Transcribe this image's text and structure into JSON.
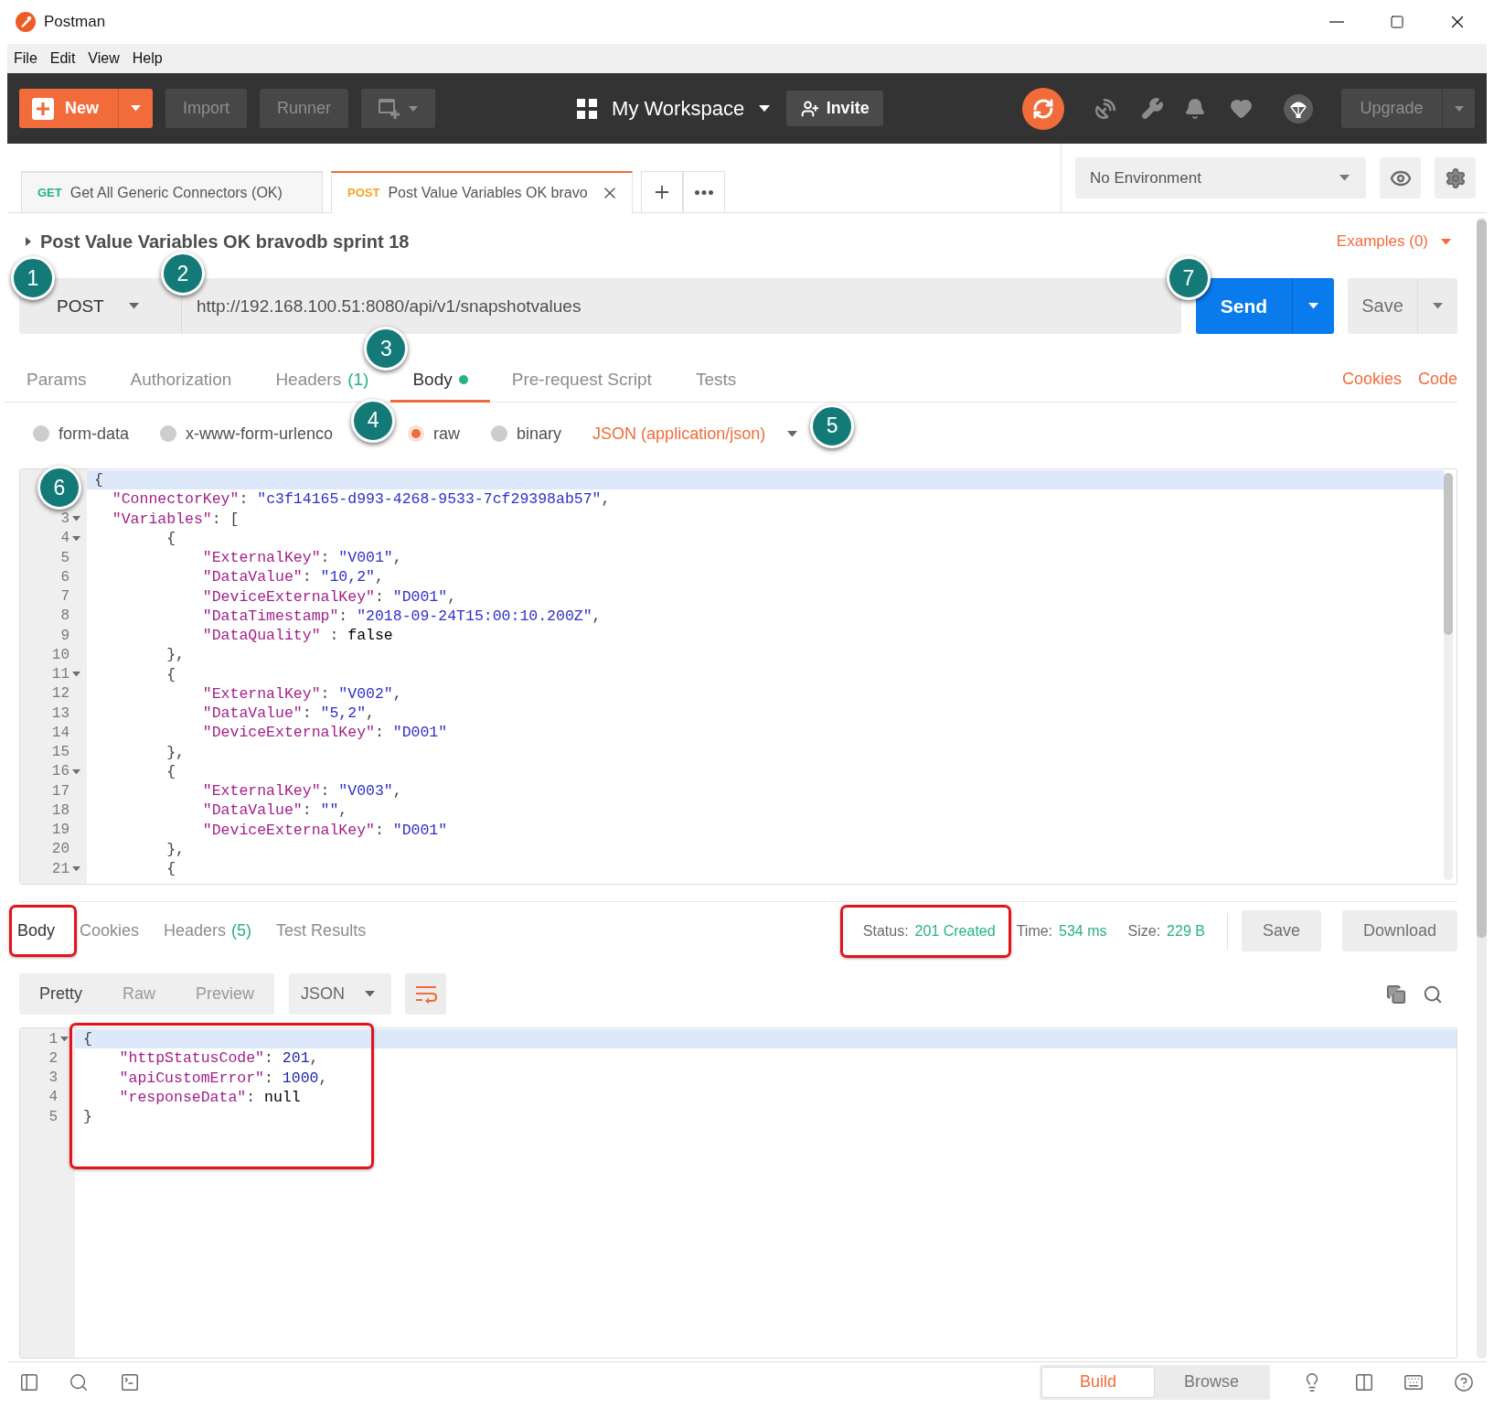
{
  "window": {
    "title": "Postman"
  },
  "menu": [
    "File",
    "Edit",
    "View",
    "Help"
  ],
  "toolbar": {
    "new": "New",
    "import": "Import",
    "runner": "Runner",
    "workspace": "My Workspace",
    "invite": "Invite",
    "upgrade": "Upgrade"
  },
  "tabs": [
    {
      "method": "GET",
      "color": "#26b47f",
      "label": "Get All Generic Connectors (OK)",
      "selected": false,
      "closable": false
    },
    {
      "method": "POST",
      "color": "#f5a623",
      "label": "Post Value Variables OK bravo",
      "selected": true,
      "closable": true
    }
  ],
  "environment": "No Environment",
  "request": {
    "title": "Post Value Variables OK bravodb sprint 18",
    "examples": "Examples (0)",
    "method": {
      "value": "POST",
      "callout": "1"
    },
    "url": {
      "value": "http://192.168.100.51:8080/api/v1/snapshotvalues",
      "callout": "2"
    },
    "send": {
      "label": "Send",
      "callout": "7"
    },
    "save": "Save"
  },
  "request_tabs": [
    {
      "label": "Params",
      "selected": false,
      "indicator": false
    },
    {
      "label": "Authorization",
      "selected": false,
      "indicator": false
    },
    {
      "label": "Headers",
      "count": "(1)",
      "selected": false,
      "indicator": false
    },
    {
      "label": "Body",
      "selected": true,
      "indicator": true,
      "callout": "3"
    },
    {
      "label": "Pre-request Script",
      "selected": false,
      "indicator": false
    },
    {
      "label": "Tests",
      "selected": false,
      "indicator": false
    }
  ],
  "request_links": [
    "Cookies",
    "Code"
  ],
  "body_types": [
    {
      "label": "form-data",
      "selected": false
    },
    {
      "label": "x-www-form-urlenco",
      "selected": false
    },
    {
      "label": "raw",
      "selected": true,
      "callout": "4"
    },
    {
      "label": "binary",
      "selected": false
    }
  ],
  "body_format": {
    "value": "JSON (application/json)",
    "callout": "5"
  },
  "editor": {
    "callout": "6",
    "lines": [
      {
        "active": true,
        "foldable": false,
        "tokens": [
          {
            "kind": "punct",
            "text": "{"
          }
        ],
        "children": [
          {
            "active": false,
            "foldable": false,
            "tokens": [
              {
                "kind": "key",
                "text": "\"ConnectorKey\""
              },
              {
                "kind": "punct",
                "text": ": "
              },
              {
                "kind": "str",
                "text": "\"c3f14165-d993-4268-9533-7cf29398ab57\""
              },
              {
                "kind": "punct",
                "text": ","
              }
            ]
          },
          {
            "number": "3",
            "active": false,
            "foldable": true,
            "tokens": [
              {
                "kind": "key",
                "text": "\"Variables\""
              },
              {
                "kind": "punct",
                "text": ": ["
              }
            ],
            "children": [
              {
                "number": "4",
                "active": false,
                "foldable": true,
                "tokens": [
                  {
                    "kind": "punct",
                    "text": "{"
                  }
                ],
                "children": [
                  {
                    "number": "5",
                    "active": false,
                    "foldable": false,
                    "tokens": [
                      {
                        "kind": "key",
                        "text": "\"ExternalKey\""
                      },
                      {
                        "kind": "punct",
                        "text": ": "
                      },
                      {
                        "kind": "str",
                        "text": "\"V001\""
                      },
                      {
                        "kind": "punct",
                        "text": ","
                      }
                    ]
                  },
                  {
                    "number": "6",
                    "active": false,
                    "foldable": false,
                    "tokens": [
                      {
                        "kind": "key",
                        "text": "\"DataValue\""
                      },
                      {
                        "kind": "punct",
                        "text": ": "
                      },
                      {
                        "kind": "str",
                        "text": "\"10,2\""
                      },
                      {
                        "kind": "punct",
                        "text": ","
                      }
                    ]
                  },
                  {
                    "number": "7",
                    "active": false,
                    "foldable": false,
                    "tokens": [
                      {
                        "kind": "key",
                        "text": "\"DeviceExternalKey\""
                      },
                      {
                        "kind": "punct",
                        "text": ": "
                      },
                      {
                        "kind": "str",
                        "text": "\"D001\""
                      },
                      {
                        "kind": "punct",
                        "text": ","
                      }
                    ]
                  },
                  {
                    "number": "8",
                    "active": false,
                    "foldable": false,
                    "tokens": [
                      {
                        "kind": "key",
                        "text": "\"DataTimestamp\""
                      },
                      {
                        "kind": "punct",
                        "text": ": "
                      },
                      {
                        "kind": "str",
                        "text": "\"2018-09-24T15:00:10.200Z\""
                      },
                      {
                        "kind": "punct",
                        "text": ","
                      }
                    ]
                  },
                  {
                    "number": "9",
                    "active": false,
                    "foldable": false,
                    "tokens": [
                      {
                        "kind": "key",
                        "text": "\"DataQuality\""
                      },
                      {
                        "kind": "punct",
                        "text": " : "
                      },
                      {
                        "kind": "kw",
                        "text": "false"
                      }
                    ]
                  }
                ]
              },
              {
                "number": "10",
                "active": false,
                "foldable": false,
                "tokens": [
                  {
                    "kind": "punct",
                    "text": "},"
                  }
                ]
              },
              {
                "number": "11",
                "active": false,
                "foldable": true,
                "tokens": [
                  {
                    "kind": "punct",
                    "text": "{"
                  }
                ],
                "children": [
                  {
                    "number": "12",
                    "active": false,
                    "foldable": false,
                    "tokens": [
                      {
                        "kind": "key",
                        "text": "\"ExternalKey\""
                      },
                      {
                        "kind": "punct",
                        "text": ": "
                      },
                      {
                        "kind": "str",
                        "text": "\"V002\""
                      },
                      {
                        "kind": "punct",
                        "text": ","
                      }
                    ]
                  },
                  {
                    "number": "13",
                    "active": false,
                    "foldable": false,
                    "tokens": [
                      {
                        "kind": "key",
                        "text": "\"DataValue\""
                      },
                      {
                        "kind": "punct",
                        "text": ": "
                      },
                      {
                        "kind": "str",
                        "text": "\"5,2\""
                      },
                      {
                        "kind": "punct",
                        "text": ","
                      }
                    ]
                  },
                  {
                    "number": "14",
                    "active": false,
                    "foldable": false,
                    "tokens": [
                      {
                        "kind": "key",
                        "text": "\"DeviceExternalKey\""
                      },
                      {
                        "kind": "punct",
                        "text": ": "
                      },
                      {
                        "kind": "str",
                        "text": "\"D001\""
                      }
                    ]
                  }
                ]
              },
              {
                "number": "15",
                "active": false,
                "foldable": false,
                "tokens": [
                  {
                    "kind": "punct",
                    "text": "},"
                  }
                ]
              },
              {
                "number": "16",
                "active": false,
                "foldable": true,
                "tokens": [
                  {
                    "kind": "punct",
                    "text": "{"
                  }
                ],
                "children": [
                  {
                    "number": "17",
                    "active": false,
                    "foldable": false,
                    "tokens": [
                      {
                        "kind": "key",
                        "text": "\"ExternalKey\""
                      },
                      {
                        "kind": "punct",
                        "text": ": "
                      },
                      {
                        "kind": "str",
                        "text": "\"V003\""
                      },
                      {
                        "kind": "punct",
                        "text": ","
                      }
                    ]
                  },
                  {
                    "number": "18",
                    "active": false,
                    "foldable": false,
                    "tokens": [
                      {
                        "kind": "key",
                        "text": "\"DataValue\""
                      },
                      {
                        "kind": "punct",
                        "text": ": "
                      },
                      {
                        "kind": "str",
                        "text": "\"\""
                      },
                      {
                        "kind": "punct",
                        "text": ","
                      }
                    ]
                  },
                  {
                    "number": "19",
                    "active": false,
                    "foldable": false,
                    "tokens": [
                      {
                        "kind": "key",
                        "text": "\"DeviceExternalKey\""
                      },
                      {
                        "kind": "punct",
                        "text": ": "
                      },
                      {
                        "kind": "str",
                        "text": "\"D001\""
                      }
                    ]
                  }
                ]
              },
              {
                "number": "20",
                "active": false,
                "foldable": false,
                "tokens": [
                  {
                    "kind": "punct",
                    "text": "},"
                  }
                ]
              },
              {
                "number": "21",
                "active": false,
                "foldable": true,
                "tokens": [
                  {
                    "kind": "punct",
                    "text": "{"
                  }
                ]
              }
            ]
          }
        ]
      }
    ]
  },
  "response": {
    "tabs": [
      {
        "label": "Body",
        "selected": true,
        "highlighted": true
      },
      {
        "label": "Cookies",
        "selected": false,
        "highlighted": false
      },
      {
        "label": "Headers",
        "count": "(5)",
        "selected": false,
        "highlighted": false
      },
      {
        "label": "Test Results",
        "selected": false,
        "highlighted": false
      }
    ],
    "stats": [
      {
        "label": "Status:",
        "value": "201 Created",
        "highlighted": true
      },
      {
        "label": "Time:",
        "value": "534 ms",
        "highlighted": false
      },
      {
        "label": "Size:",
        "value": "229 B",
        "highlighted": false
      }
    ],
    "buttons": [
      "Save",
      "Download"
    ],
    "views": [
      {
        "label": "Pretty",
        "selected": true
      },
      {
        "label": "Raw",
        "selected": false
      },
      {
        "label": "Preview",
        "selected": false
      }
    ],
    "format": "JSON",
    "body": {
      "highlighted": true,
      "lines": [
        {
          "number": "1",
          "active": true,
          "foldable": true,
          "tokens": [
            {
              "kind": "punct",
              "text": "{"
            }
          ],
          "children": [
            {
              "number": "2",
              "active": false,
              "foldable": false,
              "tokens": [
                {
                  "kind": "key",
                  "text": "\"httpStatusCode\""
                },
                {
                  "kind": "punct",
                  "text": ": "
                },
                {
                  "kind": "num",
                  "text": "201"
                },
                {
                  "kind": "punct",
                  "text": ","
                }
              ]
            },
            {
              "number": "3",
              "active": false,
              "foldable": false,
              "tokens": [
                {
                  "kind": "key",
                  "text": "\"apiCustomError\""
                },
                {
                  "kind": "punct",
                  "text": ": "
                },
                {
                  "kind": "num",
                  "text": "1000"
                },
                {
                  "kind": "punct",
                  "text": ","
                }
              ]
            },
            {
              "number": "4",
              "active": false,
              "foldable": false,
              "tokens": [
                {
                  "kind": "key",
                  "text": "\"responseData\""
                },
                {
                  "kind": "punct",
                  "text": ": "
                },
                {
                  "kind": "kw",
                  "text": "null"
                }
              ]
            }
          ]
        },
        {
          "number": "5",
          "active": false,
          "foldable": false,
          "tokens": [
            {
              "kind": "punct",
              "text": "}"
            }
          ]
        }
      ]
    }
  },
  "footer": {
    "modes": [
      {
        "label": "Build",
        "selected": true
      },
      {
        "label": "Browse",
        "selected": false
      }
    ]
  }
}
